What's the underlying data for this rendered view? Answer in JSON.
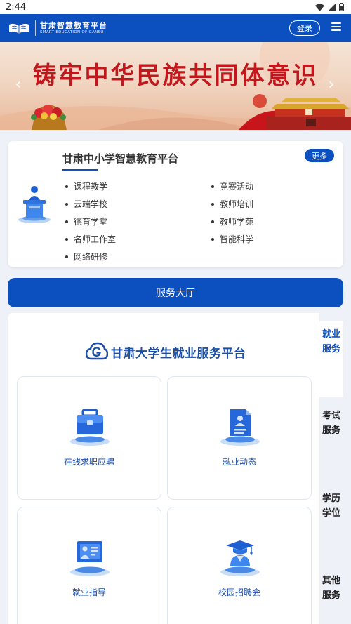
{
  "status_bar": {
    "time": "2:44"
  },
  "header": {
    "logo_cn": "甘肃智慧教育平台",
    "logo_en": "SMART EDUCATION OF GANSU",
    "login_label": "登录"
  },
  "banner": {
    "title": "铸牢中华民族共同体意识",
    "prev_arrow": "‹",
    "next_arrow": "›"
  },
  "platform_card": {
    "title": "甘肃中小学智慧教育平台",
    "more_label": "更多",
    "left_items": [
      "课程教学",
      "云端学校",
      "德育学堂",
      "名师工作室",
      "网络研修"
    ],
    "right_items": [
      "竞赛活动",
      "教师培训",
      "教师学苑",
      "智能科学"
    ]
  },
  "service_hall": {
    "label": "服务大厅"
  },
  "employment": {
    "title": "甘肃大学生就业服务平台",
    "tiles": [
      {
        "label": "在线求职应聘",
        "icon": "briefcase-icon"
      },
      {
        "label": "就业动态",
        "icon": "document-icon"
      },
      {
        "label": "就业指导",
        "icon": "presentation-icon"
      },
      {
        "label": "校园招聘会",
        "icon": "graduation-cap-icon"
      }
    ]
  },
  "side_tabs": [
    {
      "label": "就业服务",
      "active": true
    },
    {
      "label": "考试服务",
      "active": false
    },
    {
      "label": "学历学位",
      "active": false
    },
    {
      "label": "其他服务",
      "active": false
    }
  ],
  "colors": {
    "brand_blue": "#0c4fbf",
    "banner_red": "#c2181d",
    "tile_text": "#1c4fa8"
  }
}
